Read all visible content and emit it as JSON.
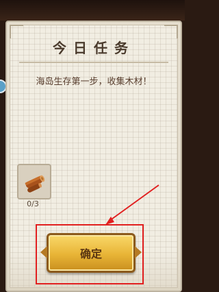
{
  "dialog": {
    "title": "今日任务",
    "mission_text": "海岛生存第一步，收集木材！",
    "item": {
      "icon": "wood-log-icon",
      "count": "0/3"
    },
    "confirm_label": "确定"
  },
  "colors": {
    "panel_bg": "#f1ede2",
    "button_gold": "#e8b436",
    "highlight_red": "#e11f1f"
  }
}
